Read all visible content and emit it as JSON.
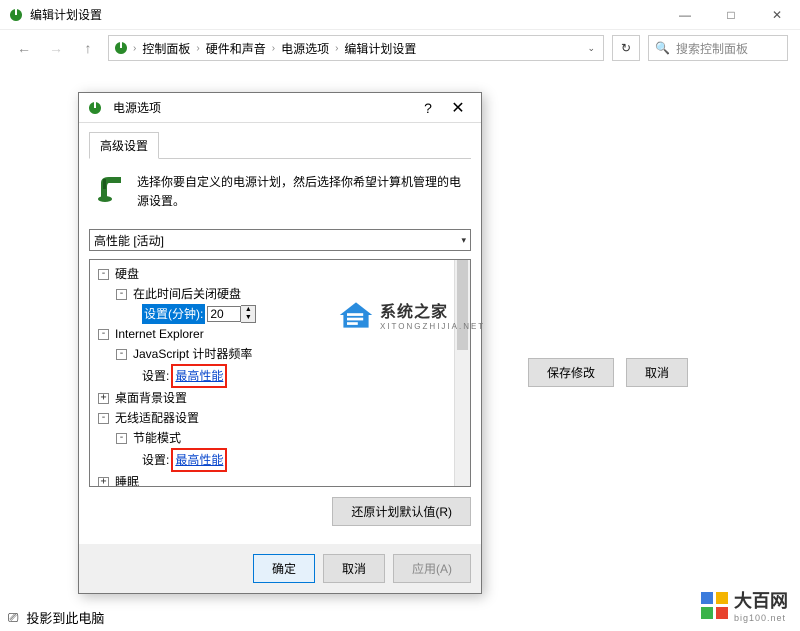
{
  "window": {
    "title": "编辑计划设置",
    "breadcrumbs": [
      "控制面板",
      "硬件和声音",
      "电源选项",
      "编辑计划设置"
    ],
    "search_placeholder": "搜索控制面板",
    "buttons": {
      "save": "保存修改",
      "cancel": "取消"
    }
  },
  "dialog": {
    "title": "电源选项",
    "tab_label": "高级设置",
    "description": "选择你要自定义的电源计划，然后选择你希望计算机管理的电源设置。",
    "plan_selected": "高性能 [活动]",
    "tree": {
      "hdd": "硬盘",
      "hdd_off": "在此时间后关闭硬盘",
      "setting_min": "设置(分钟):",
      "setting_min_val": "20",
      "ie": "Internet Explorer",
      "js_timer": "JavaScript 计时器频率",
      "setting_label": "设置:",
      "max_perf": "最高性能",
      "desktop_bg": "桌面背景设置",
      "wireless": "无线适配器设置",
      "power_save": "节能模式",
      "sleep": "睡眠"
    },
    "restore_defaults": "还原计划默认值(R)",
    "footer": {
      "ok": "确定",
      "cancel": "取消",
      "apply": "应用(A)"
    }
  },
  "taskfrag": "投影到此电脑",
  "wm1": {
    "title": "系统之家",
    "sub": "XITONGZHIJIA.NET"
  },
  "wm2": {
    "title": "大百网",
    "sub": "big100.net"
  }
}
